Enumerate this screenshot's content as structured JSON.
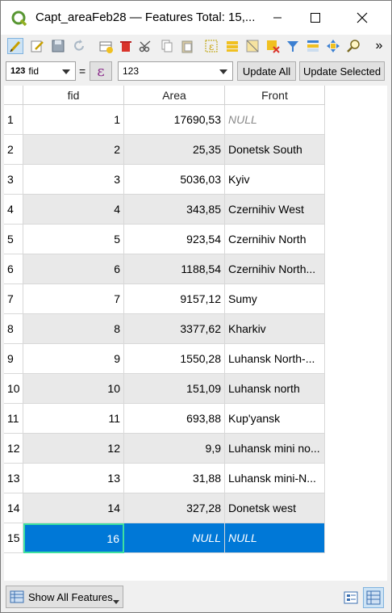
{
  "window": {
    "title": "Capt_areaFeb28 — Features Total: 15,..."
  },
  "filter": {
    "field_prefix": "123",
    "field": "fid",
    "equals": "=",
    "expression_symbol": "ε",
    "value": "123",
    "update_all": "Update All",
    "update_selected": "Update Selected"
  },
  "toolbar": {
    "overflow": "»"
  },
  "table": {
    "columns": [
      "fid",
      "Area",
      "Front"
    ],
    "rows": [
      {
        "n": "1",
        "fid": "1",
        "area": "17690,53",
        "front": "NULL"
      },
      {
        "n": "2",
        "fid": "2",
        "area": "25,35",
        "front": "Donetsk South"
      },
      {
        "n": "3",
        "fid": "3",
        "area": "5036,03",
        "front": "Kyiv"
      },
      {
        "n": "4",
        "fid": "4",
        "area": "343,85",
        "front": "Czernihiv West"
      },
      {
        "n": "5",
        "fid": "5",
        "area": "923,54",
        "front": "Czernihiv North"
      },
      {
        "n": "6",
        "fid": "6",
        "area": "1188,54",
        "front": "Czernihiv North..."
      },
      {
        "n": "7",
        "fid": "7",
        "area": "9157,12",
        "front": "Sumy"
      },
      {
        "n": "8",
        "fid": "8",
        "area": "3377,62",
        "front": "Kharkiv"
      },
      {
        "n": "9",
        "fid": "9",
        "area": "1550,28",
        "front": "Luhansk North-..."
      },
      {
        "n": "10",
        "fid": "10",
        "area": "151,09",
        "front": "Luhansk north"
      },
      {
        "n": "11",
        "fid": "11",
        "area": "693,88",
        "front": "Kup'yansk"
      },
      {
        "n": "12",
        "fid": "12",
        "area": "9,9",
        "front": "Luhansk mini no..."
      },
      {
        "n": "13",
        "fid": "13",
        "area": "31,88",
        "front": "Luhansk mini-N..."
      },
      {
        "n": "14",
        "fid": "14",
        "area": "327,28",
        "front": "Donetsk west"
      },
      {
        "n": "15",
        "fid": "16",
        "area": "NULL",
        "front": "NULL"
      }
    ]
  },
  "bottom": {
    "show_all": "Show All Features"
  },
  "colors": {
    "selection": "#0078d7",
    "alt_row": "#e9e9e9",
    "null_text": "#8a8a8a"
  }
}
